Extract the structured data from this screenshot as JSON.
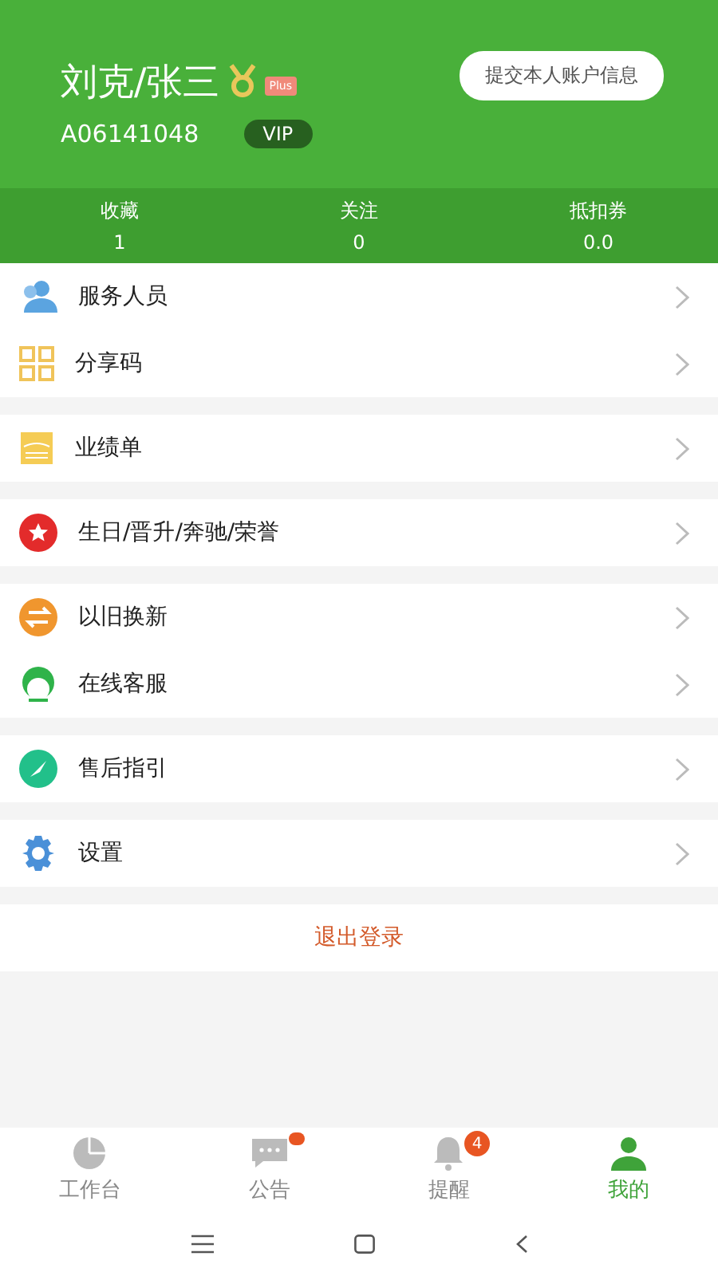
{
  "profile": {
    "name": "刘克/张三",
    "plus_badge": "Plus",
    "member_id": "A06141048",
    "vip": "VIP",
    "account_button": "提交本人账户信息"
  },
  "stats": [
    {
      "label": "收藏",
      "value": "1"
    },
    {
      "label": "关注",
      "value": "0"
    },
    {
      "label": "抵扣券",
      "value": "0.0"
    }
  ],
  "menu_groups": [
    [
      {
        "label": "服务人员"
      },
      {
        "label": "分享码"
      }
    ],
    [
      {
        "label": "业绩单"
      }
    ],
    [
      {
        "label": "生日/晋升/奔驰/荣誉"
      }
    ],
    [
      {
        "label": "以旧换新"
      },
      {
        "label": "在线客服"
      }
    ],
    [
      {
        "label": "售后指引"
      }
    ],
    [
      {
        "label": "设置"
      }
    ]
  ],
  "logout": "退出登录",
  "tab_bar": [
    {
      "label": "工作台",
      "selected": false,
      "dot": false
    },
    {
      "label": "公告",
      "selected": false,
      "dot": true
    },
    {
      "label": "提醒",
      "selected": false,
      "dot": false,
      "badge": "4"
    },
    {
      "label": "我的",
      "selected": true,
      "dot": false
    }
  ]
}
